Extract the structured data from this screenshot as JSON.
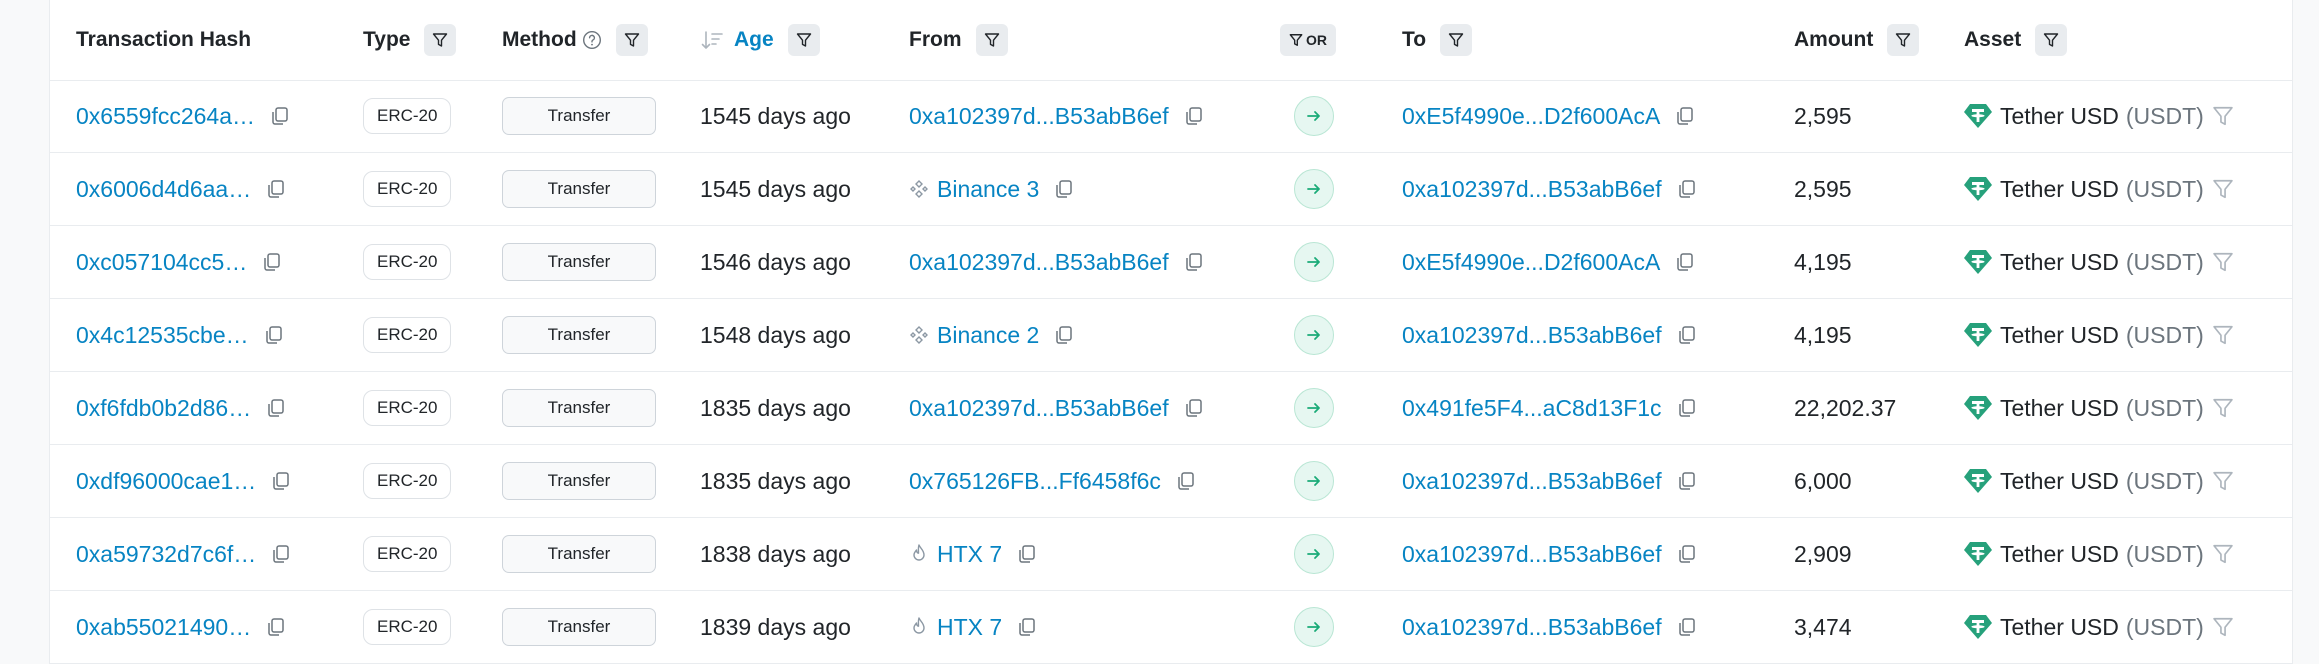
{
  "header": {
    "tx_hash": "Transaction Hash",
    "type": "Type",
    "method": "Method",
    "age": "Age",
    "from": "From",
    "or": "OR",
    "to": "To",
    "amount": "Amount",
    "asset": "Asset"
  },
  "rows": [
    {
      "hash": "0x6559fcc264a…",
      "type": "ERC-20",
      "method": "Transfer",
      "age": "1545 days ago",
      "from": "0xa102397d...B53abB6ef",
      "to": "0xE5f4990e...D2f600AcA",
      "amount": "2,595",
      "asset": "Tether USD",
      "symbol": "(USDT)"
    },
    {
      "hash": "0x6006d4d6aa…",
      "type": "ERC-20",
      "method": "Transfer",
      "age": "1545 days ago",
      "from": "Binance 3",
      "to": "0xa102397d...B53abB6ef",
      "amount": "2,595",
      "asset": "Tether USD",
      "symbol": "(USDT)"
    },
    {
      "hash": "0xc057104cc5…",
      "type": "ERC-20",
      "method": "Transfer",
      "age": "1546 days ago",
      "from": "0xa102397d...B53abB6ef",
      "to": "0xE5f4990e...D2f600AcA",
      "amount": "4,195",
      "asset": "Tether USD",
      "symbol": "(USDT)"
    },
    {
      "hash": "0x4c12535cbe…",
      "type": "ERC-20",
      "method": "Transfer",
      "age": "1548 days ago",
      "from": "Binance 2",
      "to": "0xa102397d...B53abB6ef",
      "amount": "4,195",
      "asset": "Tether USD",
      "symbol": "(USDT)"
    },
    {
      "hash": "0xf6fdb0b2d86…",
      "type": "ERC-20",
      "method": "Transfer",
      "age": "1835 days ago",
      "from": "0xa102397d...B53abB6ef",
      "to": "0x491fe5F4...aC8d13F1c",
      "amount": "22,202.37",
      "asset": "Tether USD",
      "symbol": "(USDT)"
    },
    {
      "hash": "0xdf96000cae1…",
      "type": "ERC-20",
      "method": "Transfer",
      "age": "1835 days ago",
      "from": "0x765126FB...Ff6458f6c",
      "to": "0xa102397d...B53abB6ef",
      "amount": "6,000",
      "asset": "Tether USD",
      "symbol": "(USDT)"
    },
    {
      "hash": "0xa59732d7c6f…",
      "type": "ERC-20",
      "method": "Transfer",
      "age": "1838 days ago",
      "from": "HTX 7",
      "to": "0xa102397d...B53abB6ef",
      "amount": "2,909",
      "asset": "Tether USD",
      "symbol": "(USDT)"
    },
    {
      "hash": "0xab55021490…",
      "type": "ERC-20",
      "method": "Transfer",
      "age": "1839 days ago",
      "from": "HTX 7",
      "to": "0xa102397d...B53abB6ef",
      "amount": "3,474",
      "asset": "Tether USD",
      "symbol": "(USDT)"
    }
  ],
  "from_icons": [
    "",
    "binance-icon",
    "",
    "binance-icon",
    "",
    "",
    "htx-flame-icon",
    "htx-flame-icon"
  ],
  "colors": {
    "link": "#0784c3",
    "tether": "#26a17b",
    "arrow": "#1aab78"
  }
}
